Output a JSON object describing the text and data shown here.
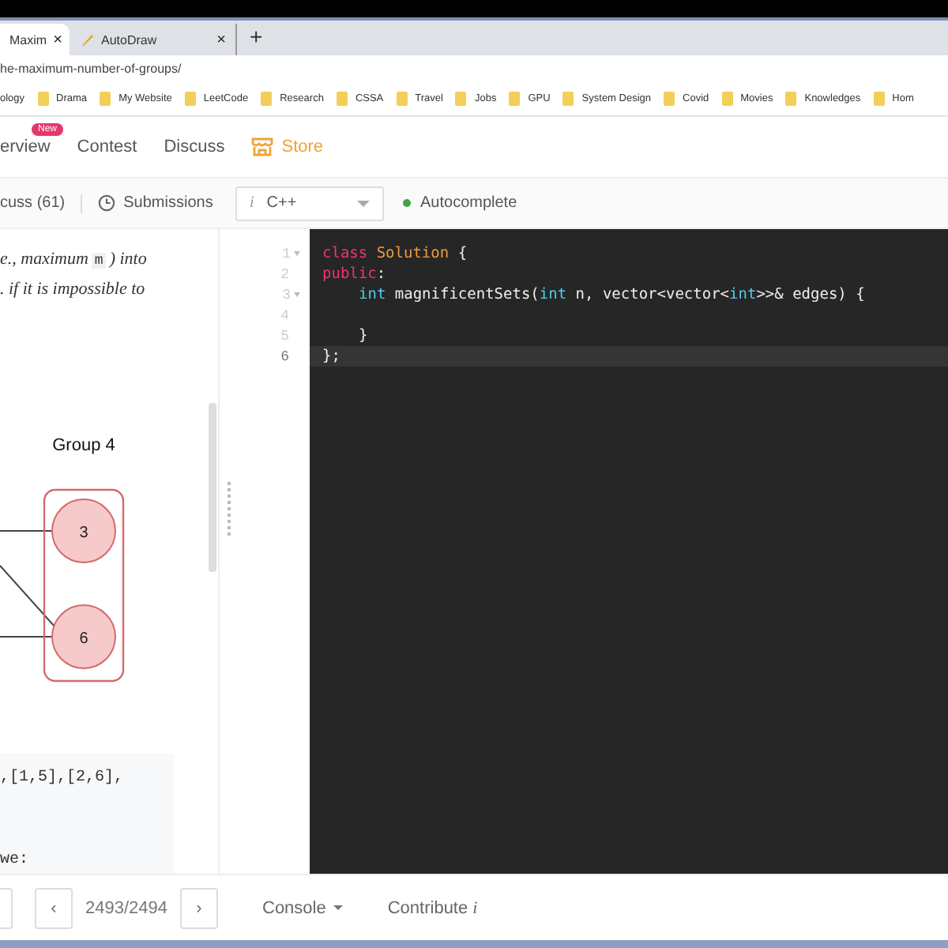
{
  "browser": {
    "tabs": [
      {
        "title": "Maxim",
        "close": "×",
        "selected": true
      },
      {
        "title": "AutoDraw",
        "close": "×",
        "selected": false
      }
    ],
    "new_tab": "+",
    "url": "he-maximum-number-of-groups/",
    "bookmarks": [
      "ology",
      "Drama",
      "My Website",
      "LeetCode",
      "Research",
      "CSSA",
      "Travel",
      "Jobs",
      "GPU",
      "System Design",
      "Covid",
      "Movies",
      "Knowledges",
      "Hom"
    ]
  },
  "nav": [
    {
      "label": "erview",
      "kind": "link",
      "badge": "New"
    },
    {
      "label": "Contest",
      "kind": "link"
    },
    {
      "label": "Discuss",
      "kind": "link"
    },
    {
      "label": "Store",
      "kind": "store"
    }
  ],
  "panel_tabs": [
    {
      "label": "cuss (61)",
      "kind": "plain"
    },
    {
      "label": "Submissions",
      "kind": "clock"
    }
  ],
  "language": {
    "info": "i",
    "value": "C++"
  },
  "autocomplete": {
    "label": "Autocomplete",
    "on": true
  },
  "description": [
    [
      {
        "kind": "text",
        "text": "e., maximum"
      },
      {
        "kind": "code",
        "text": "m"
      },
      {
        "kind": "text",
        "text": ") into"
      }
    ],
    [
      {
        "kind": "text",
        "text": ". if it is impossible to"
      }
    ]
  ],
  "diagram": {
    "group_label": "Group 4",
    "nodes": [
      "3",
      "6"
    ]
  },
  "example": [
    ",[1,5],[2,6],",
    "we:"
  ],
  "editor": {
    "lines": [
      {
        "number": "1",
        "foldable": true,
        "active": false,
        "indent": false,
        "tokens": [
          {
            "kind": "keyword",
            "text": "class "
          },
          {
            "kind": "name",
            "text": "Solution"
          },
          {
            "kind": "plain",
            "text": " {"
          }
        ]
      },
      {
        "number": "2",
        "foldable": false,
        "active": false,
        "indent": false,
        "tokens": [
          {
            "kind": "keyword",
            "text": "public"
          },
          {
            "kind": "plain",
            "text": ":"
          }
        ]
      },
      {
        "number": "3",
        "foldable": true,
        "active": false,
        "indent": true,
        "tokens": [
          {
            "kind": "type",
            "text": "int"
          },
          {
            "kind": "plain",
            "text": " magnificentSets("
          },
          {
            "kind": "type",
            "text": "int"
          },
          {
            "kind": "plain",
            "text": " n, vector<vector<"
          },
          {
            "kind": "type",
            "text": "int"
          },
          {
            "kind": "plain",
            "text": ">>& edges) {"
          }
        ]
      },
      {
        "number": "4",
        "foldable": false,
        "active": false
      },
      {
        "number": "5",
        "foldable": false,
        "active": false,
        "indent": true,
        "tokens": [
          {
            "kind": "plain",
            "text": "}"
          }
        ]
      },
      {
        "number": "6",
        "foldable": false,
        "active": true,
        "indent": false,
        "tokens": [
          {
            "kind": "plain",
            "text": "};"
          }
        ]
      }
    ]
  },
  "footer": {
    "prev": "‹",
    "pager": "2493/2494",
    "next": "›",
    "console": "Console",
    "contribute": "Contribute",
    "contribute_info": "i"
  }
}
